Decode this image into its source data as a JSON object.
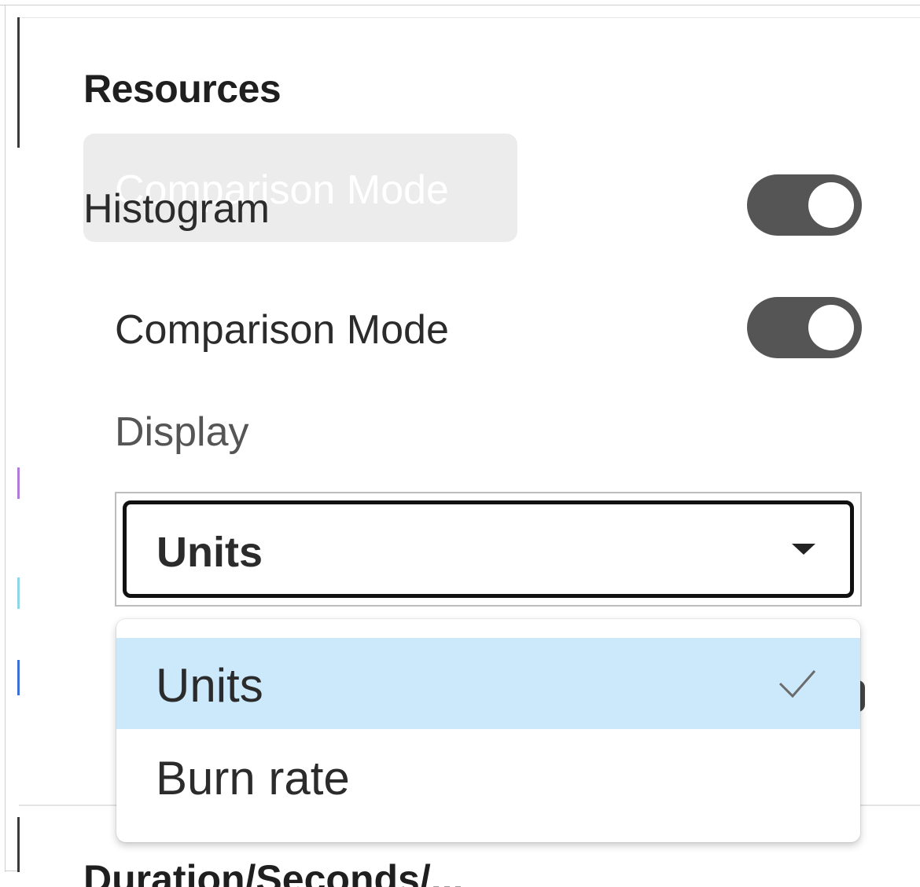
{
  "panel": {
    "section_title": "Resources",
    "drag_ghost_label": "Comparison Mode",
    "next_section_title": "Duration/Seconds/..."
  },
  "rows": {
    "histogram": {
      "label": "Histogram",
      "enabled": true
    },
    "comparison_mode": {
      "label": "Comparison Mode",
      "enabled": true
    }
  },
  "display": {
    "label": "Display",
    "selected_value": "Units",
    "options": [
      {
        "label": "Units",
        "selected": true,
        "icon": "check-icon"
      },
      {
        "label": "Burn rate",
        "selected": false
      }
    ]
  },
  "colors": {
    "toggle_track": "#555555",
    "selected_option_bg": "#cce8fb",
    "select_border": "#111111"
  }
}
